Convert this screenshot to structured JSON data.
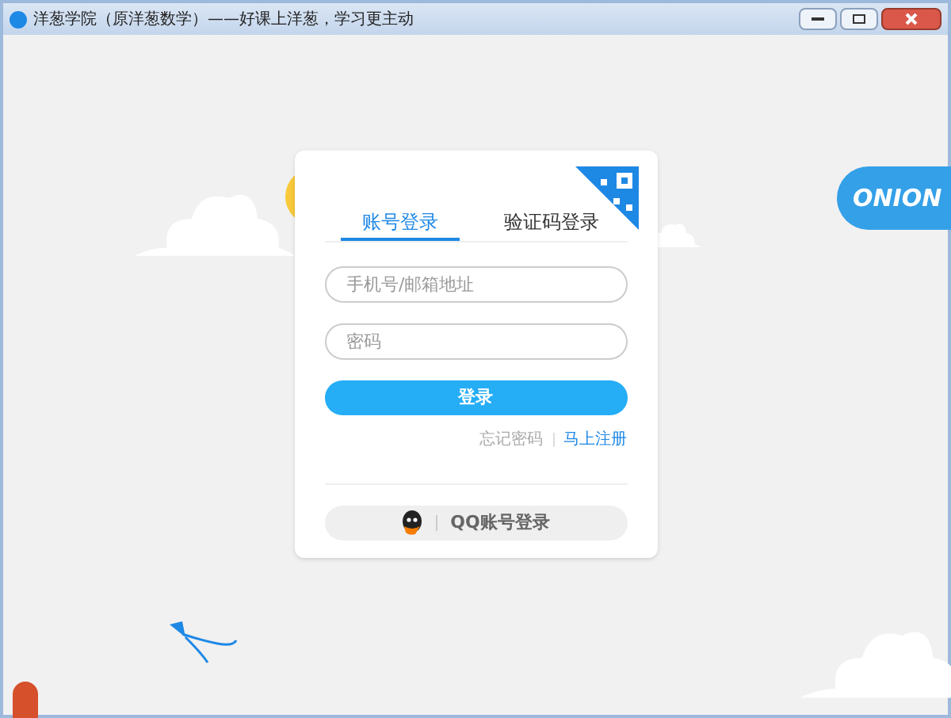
{
  "window": {
    "title": "洋葱学院（原洋葱数学）——好课上洋葱，学习更主动"
  },
  "tabs": [
    {
      "label": "账号登录",
      "selected": true
    },
    {
      "label": "验证码登录",
      "selected": false
    }
  ],
  "fields": [
    {
      "placeholder": "手机号/邮箱地址"
    },
    {
      "placeholder": "密码"
    }
  ],
  "login_button": "登录",
  "forgot_link": "忘记密码",
  "register_link": "马上注册",
  "qq_login": "QQ账号登录",
  "airship_text": "ONION"
}
